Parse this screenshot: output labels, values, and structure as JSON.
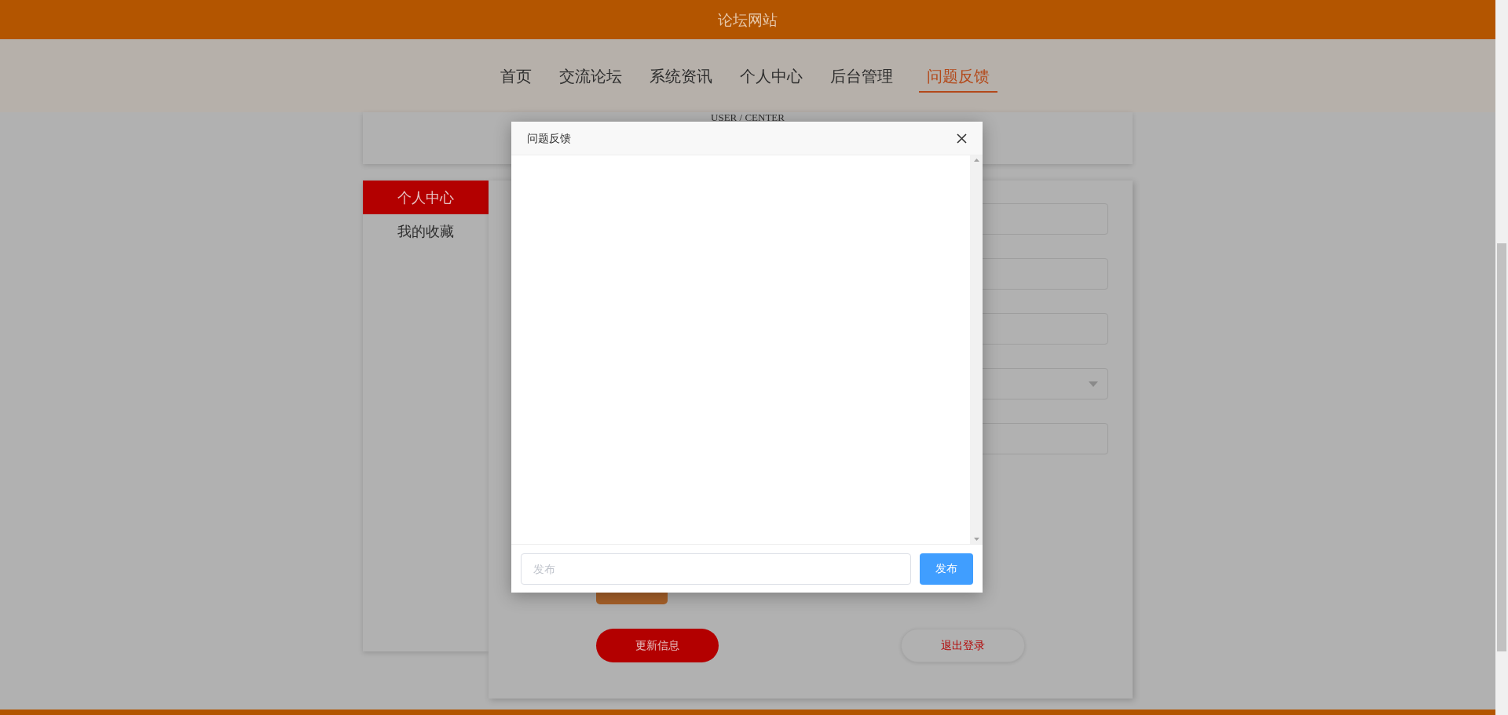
{
  "header": {
    "title": "论坛网站"
  },
  "nav": [
    {
      "label": "首页",
      "selected": false
    },
    {
      "label": "交流论坛",
      "selected": false
    },
    {
      "label": "系统资讯",
      "selected": false
    },
    {
      "label": "个人中心",
      "selected": false
    },
    {
      "label": "后台管理",
      "selected": false
    },
    {
      "label": "问题反馈",
      "selected": true
    }
  ],
  "banner": {
    "title": "USER / CENTER"
  },
  "sidebar": [
    {
      "label": "个人中心",
      "selected": true
    },
    {
      "label": "我的收藏",
      "selected": false
    }
  ],
  "form": {
    "fields": [
      {
        "kind": "text"
      },
      {
        "kind": "text"
      },
      {
        "kind": "text"
      },
      {
        "kind": "select"
      },
      {
        "kind": "text"
      }
    ],
    "buttons": [
      {
        "label": "更新信息",
        "kind": "primary"
      },
      {
        "label": "退出登录",
        "kind": "outline"
      }
    ]
  },
  "dialog": {
    "title": "问题反馈",
    "input": {
      "placeholder": "发布"
    },
    "submit": "发布"
  }
}
